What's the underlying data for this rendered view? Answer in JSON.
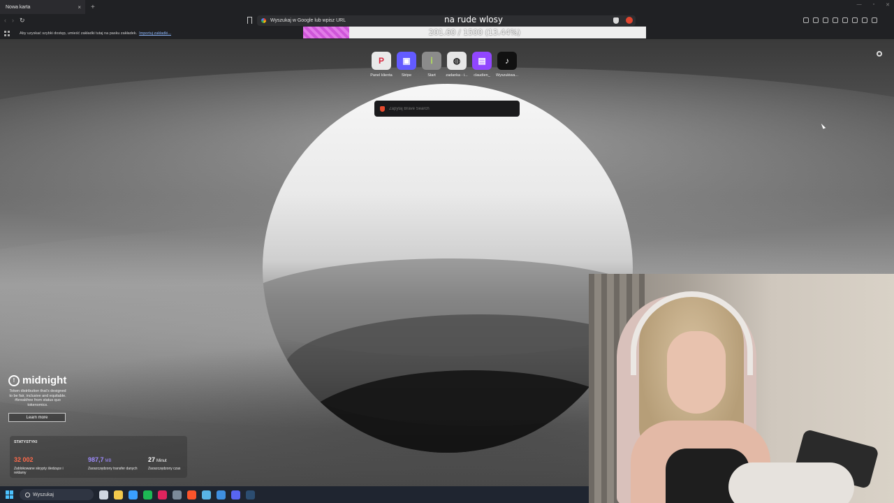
{
  "browser": {
    "tab_title": "Nowa karta",
    "tab_close": "×",
    "new_tab": "+",
    "window_controls": [
      "—",
      "▫",
      "✕"
    ],
    "nav": {
      "back": "‹",
      "forward": "›",
      "reload": "↻"
    },
    "url_placeholder": "Wyszukaj w Google lub wpisz URL",
    "bookmarks_bar": {
      "hint": "Aby uzyskać szybki dostęp, umieść zakładki tutaj na pasku zakładek.",
      "import_link": "Importuj zakładki..."
    }
  },
  "overlay": {
    "goal_title": "na rude wlosy",
    "goal_text": "201.60 / 1500 (13.44%)",
    "goal_current": 201.6,
    "goal_total": 1500,
    "goal_fraction": 0.1344,
    "goal_color": "#d865e0"
  },
  "new_tab_page": {
    "tiles": [
      {
        "label": "Panel klienta",
        "icon": "p-logo-icon",
        "glyph": "P",
        "bg": "#e9e9e9",
        "fg": "#d7263d"
      },
      {
        "label": "Stripe",
        "icon": "stripe-icon",
        "glyph": "▣",
        "bg": "#635bff",
        "fg": "#ffffff"
      },
      {
        "label": "Start",
        "icon": "start-icon",
        "glyph": "ⅰ",
        "bg": "#8b8b8b",
        "fg": "#b5e35b"
      },
      {
        "label": "zadanka - i...",
        "icon": "globe-icon",
        "glyph": "◍",
        "bg": "#e6e6e6",
        "fg": "#222222"
      },
      {
        "label": "claudien_",
        "icon": "twitch-icon",
        "glyph": "▤",
        "bg": "#9146ff",
        "fg": "#ffffff"
      },
      {
        "label": "Wyszukiwa...",
        "icon": "tiktok-icon",
        "glyph": "♪",
        "bg": "#111111",
        "fg": "#ffffff"
      }
    ],
    "brave_search_placeholder": "Zapytaj Brave Search",
    "midnight": {
      "logo_text": "midnight",
      "logo_glyph": "!",
      "tagline": "Token distribution that's designed to be fair, inclusive and equitable. #breakfree from status quo tokenomics.",
      "button": "Learn more"
    },
    "stats": {
      "title": "STATYSTYKI",
      "items": [
        {
          "value": "32 002",
          "unit": "",
          "label": "Zablokowane skrypty śledzące i reklamy",
          "color": "#ff6a4a"
        },
        {
          "value": "987,7",
          "unit": "MB",
          "label": "Zaoszczędzony transfer danych",
          "color": "#9f8cff"
        },
        {
          "value": "27",
          "unit": "Minut",
          "label": "Zaoszczędzony czas",
          "color": "#ffffff"
        }
      ]
    }
  },
  "taskbar": {
    "search_label": "Wyszukaj",
    "apps": [
      {
        "name": "task-view-icon",
        "color": "#cfd6e0"
      },
      {
        "name": "file-explorer-icon",
        "color": "#f2c94c"
      },
      {
        "name": "store-icon",
        "color": "#3aa0ff"
      },
      {
        "name": "spotify-icon",
        "color": "#1db954"
      },
      {
        "name": "opera-icon",
        "color": "#e0245e"
      },
      {
        "name": "chrome-icon",
        "color": "#7c8a99"
      },
      {
        "name": "brave-icon",
        "color": "#fb542b"
      },
      {
        "name": "notepad-icon",
        "color": "#59b4e6"
      },
      {
        "name": "document-icon",
        "color": "#3f8fe0"
      },
      {
        "name": "discord-icon",
        "color": "#5865f2"
      },
      {
        "name": "steam-icon",
        "color": "#2c4d70"
      }
    ]
  }
}
